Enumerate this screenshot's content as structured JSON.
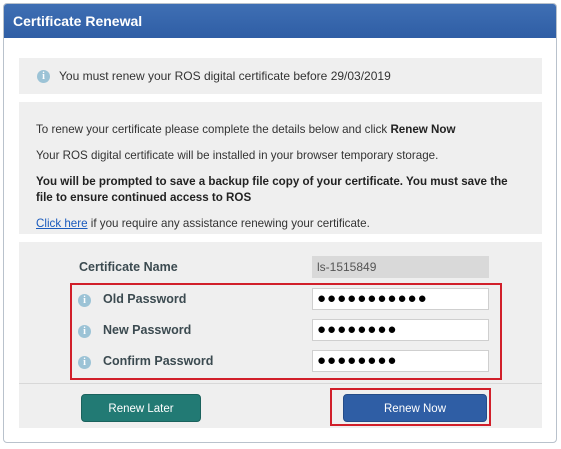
{
  "dialog": {
    "title": "Certificate Renewal"
  },
  "notice": {
    "text": "You must renew your ROS digital certificate before 29/03/2019"
  },
  "intro": {
    "line1_prefix": "To renew your certificate please complete the details below and click ",
    "line1_bold": "Renew Now",
    "line2": "Your ROS digital certificate will be installed in your browser temporary storage.",
    "line3": "You will be prompted to save a backup file copy of your certificate. You must save the file to ensure continued access to ROS",
    "link_text": "Click here",
    "line4_suffix": " if you require any assistance renewing your certificate."
  },
  "form": {
    "certificate_name_label": "Certificate Name",
    "certificate_name_value": "ls-1515849",
    "old_password_label": "Old Password",
    "old_password_value": "●●●●●●●●●●●",
    "new_password_label": "New Password",
    "new_password_value": "●●●●●●●●",
    "confirm_password_label": "Confirm Password",
    "confirm_password_value": "●●●●●●●●"
  },
  "buttons": {
    "renew_later": "Renew Later",
    "renew_now": "Renew Now"
  },
  "icons": {
    "info": "i"
  }
}
